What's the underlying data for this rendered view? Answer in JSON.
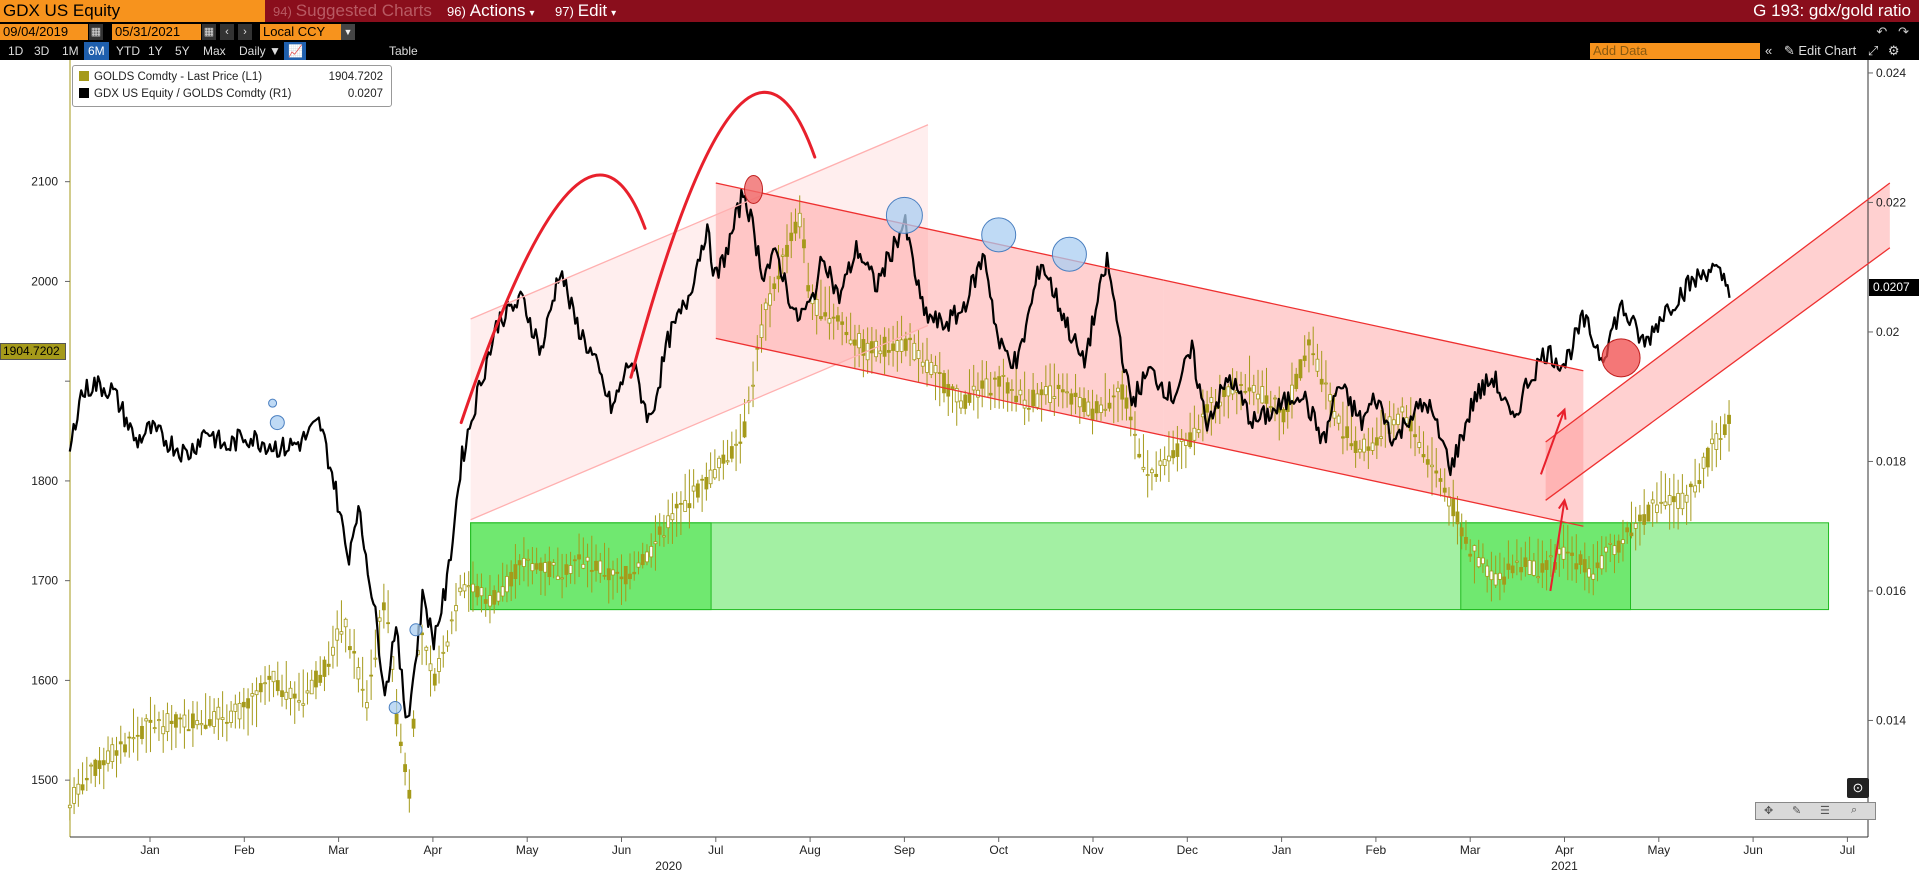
{
  "toolbar": {
    "ticker": "GDX US Equity",
    "suggested_charts": "Suggested Charts",
    "suggested_num": "94)",
    "actions": "Actions",
    "actions_num": "96)",
    "edit": "Edit",
    "edit_num": "97)",
    "chart_title": "G 193: gdx/gold ratio"
  },
  "dates": {
    "start": "09/04/2019",
    "end": "05/31/2021",
    "currency": "Local CCY"
  },
  "ranges": [
    "1D",
    "3D",
    "1M",
    "6M",
    "YTD",
    "1Y",
    "5Y",
    "Max"
  ],
  "active_range": "6M",
  "frequency": "Daily",
  "table_label": "Table",
  "add_data_placeholder": "Add Data",
  "edit_chart_label": "Edit Chart",
  "legend": [
    {
      "name": "GOLDS Comdty - Last Price (L1)",
      "value": "1904.7202",
      "color": "#a59a1a"
    },
    {
      "name": "GDX US Equity / GOLDS Comdty (R1)",
      "value": "0.0207",
      "color": "#000000"
    }
  ],
  "last_values": {
    "left": "1904.7202",
    "right": "0.0207"
  },
  "colors": {
    "topbar": "#8a0e1c",
    "orange": "#f7931d",
    "gold": "#a59a1a",
    "ratio": "#000000",
    "channel_red": "#e23a3a",
    "zone_green": "#33dd33"
  },
  "chart_data": {
    "type": "line",
    "x_ticks": [
      "Jan",
      "Feb",
      "Mar",
      "Apr",
      "May",
      "Jun",
      "Jul",
      "Aug",
      "Sep",
      "Oct",
      "Nov",
      "Dec",
      "Jan",
      "Feb",
      "Mar",
      "Apr",
      "May",
      "Jun",
      "Jul"
    ],
    "year_labels": [
      {
        "label": "2020",
        "month_index": 5.5
      },
      {
        "label": "2021",
        "month_index": 15.0
      }
    ],
    "left_axis": {
      "ticks": [
        1500,
        1600,
        1700,
        1800,
        1900,
        2000,
        2100
      ],
      "labels": [
        "1500",
        "1600",
        "1700",
        "1800",
        "2000",
        "2100"
      ],
      "range": [
        1443,
        2222
      ]
    },
    "right_axis": {
      "ticks": [
        0.014,
        0.016,
        0.018,
        0.02,
        0.022,
        0.024
      ],
      "labels": [
        "0.014",
        "0.016",
        "0.018",
        "0.02",
        "0.022",
        "0.024"
      ],
      "range": [
        0.0122,
        0.0242
      ]
    },
    "series": [
      {
        "name": "GOLDS Comdty - Last Price",
        "axis": "left",
        "style": "ohlc",
        "x": [
          -0.85,
          -0.5,
          0,
          0.5,
          1.0,
          1.3,
          1.6,
          1.9,
          2.05,
          2.3,
          2.5,
          2.62,
          2.75,
          2.85,
          3.0,
          3.1,
          3.3,
          3.6,
          4.0,
          4.3,
          4.6,
          5.0,
          5.3,
          5.5,
          5.7,
          6.0,
          6.3,
          6.5,
          6.7,
          6.9,
          7.0,
          7.3,
          7.6,
          8.0,
          8.3,
          8.6,
          9.0,
          9.3,
          9.6,
          10.0,
          10.3,
          10.6,
          11.0,
          11.3,
          11.6,
          11.9,
          12.0,
          12.3,
          12.6,
          12.8,
          13.0,
          13.3,
          13.55,
          13.7,
          14.0,
          14.3,
          14.5,
          14.8,
          15.0,
          15.3,
          15.6,
          15.8,
          16.0,
          16.3,
          16.55,
          16.75
        ],
        "values": [
          1480,
          1520,
          1555,
          1560,
          1570,
          1600,
          1580,
          1620,
          1660,
          1580,
          1690,
          1560,
          1490,
          1650,
          1600,
          1620,
          1700,
          1680,
          1720,
          1710,
          1720,
          1700,
          1730,
          1760,
          1780,
          1810,
          1850,
          1960,
          2020,
          2065,
          1980,
          1960,
          1930,
          1940,
          1910,
          1880,
          1900,
          1880,
          1890,
          1870,
          1890,
          1800,
          1840,
          1880,
          1900,
          1880,
          1860,
          1940,
          1860,
          1830,
          1840,
          1870,
          1820,
          1800,
          1730,
          1700,
          1720,
          1710,
          1730,
          1710,
          1740,
          1760,
          1780,
          1780,
          1830,
          1860
        ]
      },
      {
        "name": "GDX US Equity / GOLDS Comdty",
        "axis": "right",
        "style": "line",
        "x": [
          -0.85,
          -0.75,
          -0.6,
          -0.4,
          -0.3,
          -0.15,
          0.0,
          0.2,
          0.4,
          0.6,
          0.8,
          1.0,
          1.2,
          1.4,
          1.6,
          1.8,
          1.95,
          2.1,
          2.2,
          2.3,
          2.4,
          2.5,
          2.6,
          2.72,
          2.78,
          2.9,
          3.0,
          3.15,
          3.3,
          3.5,
          3.7,
          3.95,
          4.15,
          4.35,
          4.5,
          4.7,
          4.9,
          5.1,
          5.3,
          5.5,
          5.7,
          5.9,
          6.0,
          6.15,
          6.3,
          6.5,
          6.65,
          6.85,
          7.0,
          7.15,
          7.3,
          7.5,
          7.7,
          7.85,
          8.0,
          8.2,
          8.4,
          8.6,
          8.85,
          9.0,
          9.2,
          9.45,
          9.7,
          9.9,
          10.15,
          10.4,
          10.6,
          10.85,
          11.05,
          11.2,
          11.45,
          11.7,
          11.95,
          12.2,
          12.45,
          12.6,
          12.85,
          13.0,
          13.2,
          13.35,
          13.55,
          13.8,
          14.05,
          14.25,
          14.45,
          14.6,
          14.8,
          15.0,
          15.2,
          15.4,
          15.6,
          15.85,
          16.05,
          16.3,
          16.55,
          16.75
        ],
        "values": [
          0.0181,
          0.019,
          0.0192,
          0.0191,
          0.0188,
          0.0183,
          0.0185,
          0.0183,
          0.0181,
          0.0185,
          0.0182,
          0.0184,
          0.0183,
          0.0182,
          0.0183,
          0.0186,
          0.0177,
          0.0165,
          0.0173,
          0.0165,
          0.0155,
          0.0144,
          0.0155,
          0.014,
          0.0145,
          0.016,
          0.0152,
          0.0161,
          0.018,
          0.0192,
          0.0202,
          0.0205,
          0.0197,
          0.021,
          0.0202,
          0.0196,
          0.0188,
          0.0196,
          0.0186,
          0.0199,
          0.0205,
          0.0216,
          0.0208,
          0.0214,
          0.0222,
          0.0209,
          0.0212,
          0.0202,
          0.0204,
          0.0212,
          0.0205,
          0.0213,
          0.0207,
          0.0212,
          0.0217,
          0.0203,
          0.0201,
          0.0203,
          0.0212,
          0.0198,
          0.0195,
          0.0211,
          0.0202,
          0.0195,
          0.0211,
          0.0189,
          0.0194,
          0.019,
          0.0197,
          0.0186,
          0.0193,
          0.0186,
          0.0188,
          0.0191,
          0.0183,
          0.0192,
          0.0186,
          0.019,
          0.0183,
          0.0187,
          0.0189,
          0.0179,
          0.019,
          0.0193,
          0.0186,
          0.0192,
          0.0197,
          0.0195,
          0.0202,
          0.0196,
          0.0204,
          0.0198,
          0.0203,
          0.0207,
          0.021,
          0.0207
        ]
      }
    ],
    "annotations": [
      {
        "type": "channel",
        "color": "#ff9e9e",
        "x": [
          3.4,
          8.25
        ],
        "y_start": [
          0.0202,
          0.0232
        ],
        "y_end": [
          0.0171,
          0.0201
        ],
        "axis": "right"
      },
      {
        "type": "channel",
        "color": "#ff8a8a",
        "x": [
          6.0,
          10.75
        ],
        "y_start": [
          0.0223,
          0.0208
        ],
        "y_end": [
          0.0199,
          0.0184
        ],
        "axis": "right"
      },
      {
        "type": "channel",
        "color": "#ff8a8a",
        "x": [
          10.75,
          15.2
        ],
        "y_start": [
          0.0208,
          0.0194
        ],
        "y_end": [
          0.0184,
          0.017
        ],
        "axis": "right"
      },
      {
        "type": "channel",
        "color": "#ff8a8a",
        "x": [
          14.8,
          18.45
        ],
        "y_start": [
          0.0183,
          0.0223
        ],
        "y_end": [
          0.0174,
          0.0213
        ],
        "axis": "right"
      },
      {
        "type": "zone",
        "color": "#33dd33",
        "x": [
          3.4,
          17.8
        ],
        "y": [
          1671,
          1758
        ],
        "axis": "left"
      },
      {
        "type": "zone",
        "color": "#33dd33",
        "x": [
          3.4,
          5.95
        ],
        "y": [
          1671,
          1758
        ],
        "axis": "left"
      },
      {
        "type": "zone",
        "color": "#33dd33",
        "x": [
          13.9,
          15.7
        ],
        "y": [
          1671,
          1758
        ],
        "axis": "left"
      }
    ]
  }
}
